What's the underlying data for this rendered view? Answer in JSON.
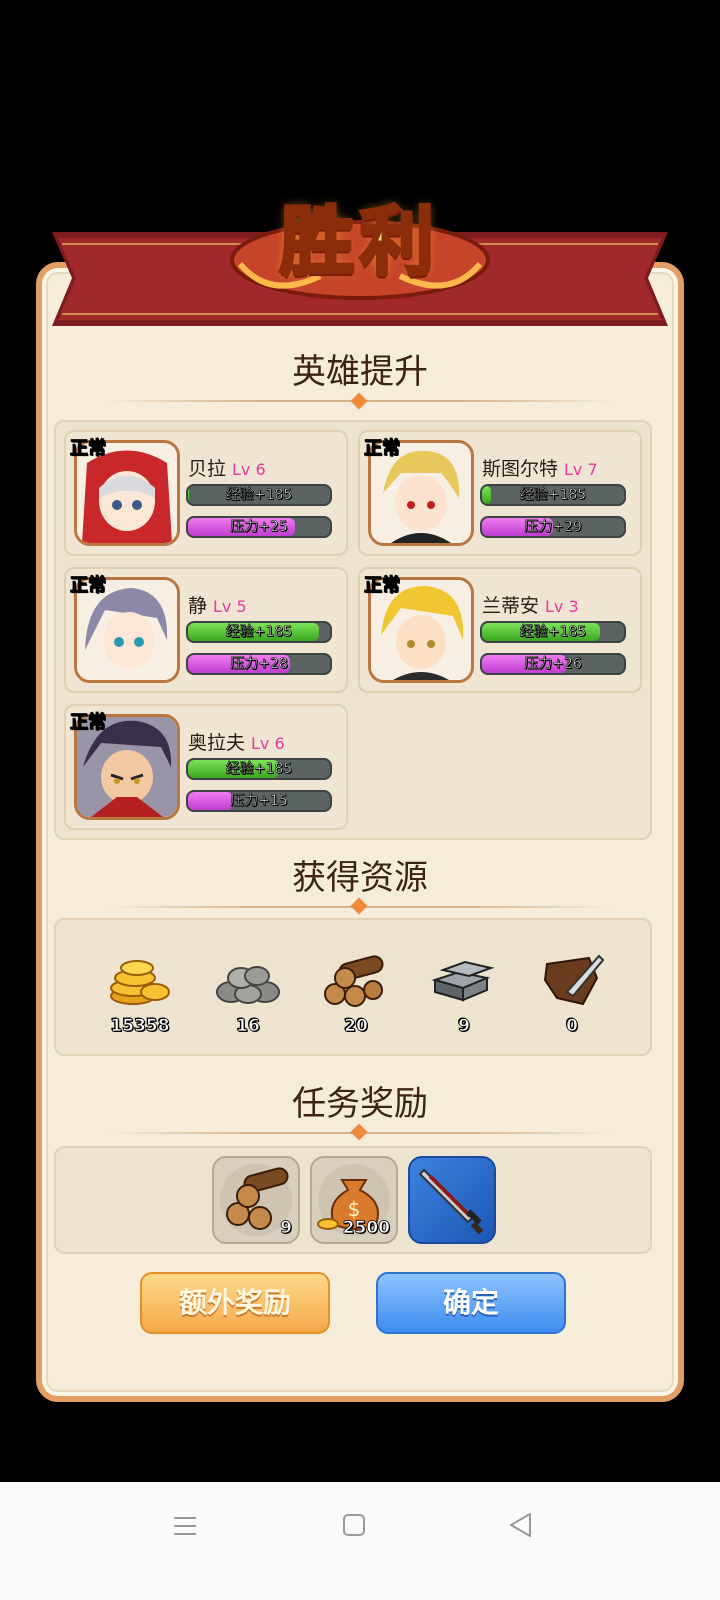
{
  "header": {
    "title": "胜利"
  },
  "sections": {
    "heroes_title": "英雄提升",
    "resources_title": "获得资源",
    "quest_title": "任务奖励"
  },
  "heroes": [
    {
      "status": "正常",
      "name": "贝拉",
      "level": "Lv 6",
      "exp_label": "经验+185",
      "exp_fill": 0.01,
      "stress_label": "压力+25",
      "stress_fill": 0.75
    },
    {
      "status": "正常",
      "name": "斯图尔特",
      "level": "Lv 7",
      "exp_label": "经验+185",
      "exp_fill": 0.06,
      "stress_label": "压力+29",
      "stress_fill": 0.5
    },
    {
      "status": "正常",
      "name": "静",
      "level": "Lv 5",
      "exp_label": "经验+185",
      "exp_fill": 0.92,
      "stress_label": "压力+28",
      "stress_fill": 0.72
    },
    {
      "status": "正常",
      "name": "兰蒂安",
      "level": "Lv 3",
      "exp_label": "经验+185",
      "exp_fill": 0.83,
      "stress_label": "压力+26",
      "stress_fill": 0.6
    },
    {
      "status": "正常",
      "name": "奥拉夫",
      "level": "Lv 6",
      "exp_label": "经验+185",
      "exp_fill": 0.64,
      "stress_label": "压力+15",
      "stress_fill": 0.32
    }
  ],
  "resources": [
    {
      "icon": "gold-coins-icon",
      "value": "15358"
    },
    {
      "icon": "stone-icon",
      "value": "16"
    },
    {
      "icon": "wood-logs-icon",
      "value": "20"
    },
    {
      "icon": "iron-ingot-icon",
      "value": "9"
    },
    {
      "icon": "leather-icon",
      "value": "0"
    }
  ],
  "quest_rewards": [
    {
      "icon": "wood-logs-icon",
      "value": "9"
    },
    {
      "icon": "money-bag-icon",
      "value": "2500"
    },
    {
      "icon": "sword-icon",
      "value": ""
    }
  ],
  "buttons": {
    "extra": "额外奖励",
    "confirm": "确定"
  },
  "colors": {
    "exp_bar": "#4fbf2a",
    "stress_bar": "#d55be0",
    "level_text": "#e23aa0",
    "frame": "#e49d63"
  }
}
